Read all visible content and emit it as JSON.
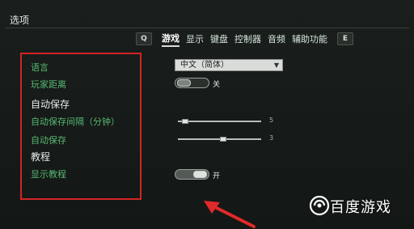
{
  "window": {
    "title": "选项"
  },
  "tabs": {
    "key_left": "Q",
    "key_right": "E",
    "items": [
      "游戏",
      "显示",
      "键盘",
      "控制器",
      "音频",
      "辅助功能"
    ],
    "active": "游戏"
  },
  "settings": {
    "language": {
      "label": "语言",
      "value": "中文（简体）"
    },
    "player_distance": {
      "label": "玩家距离",
      "toggle_text": "关",
      "state": "off"
    },
    "autosave_header": {
      "label": "自动保存"
    },
    "autosave_interval": {
      "label": "自动保存间隔（分钟）",
      "value": "5",
      "fraction": 0.05
    },
    "autosave_count": {
      "label": "自动保存",
      "value": "3",
      "fraction": 0.55
    },
    "tutorial_header": {
      "label": "教程"
    },
    "show_tutorial": {
      "label": "显示教程",
      "toggle_text": "开",
      "state": "on"
    }
  },
  "watermark": {
    "text": "百度游戏"
  },
  "colors": {
    "accent_green": "#56b872",
    "highlight_red": "#d32424"
  }
}
